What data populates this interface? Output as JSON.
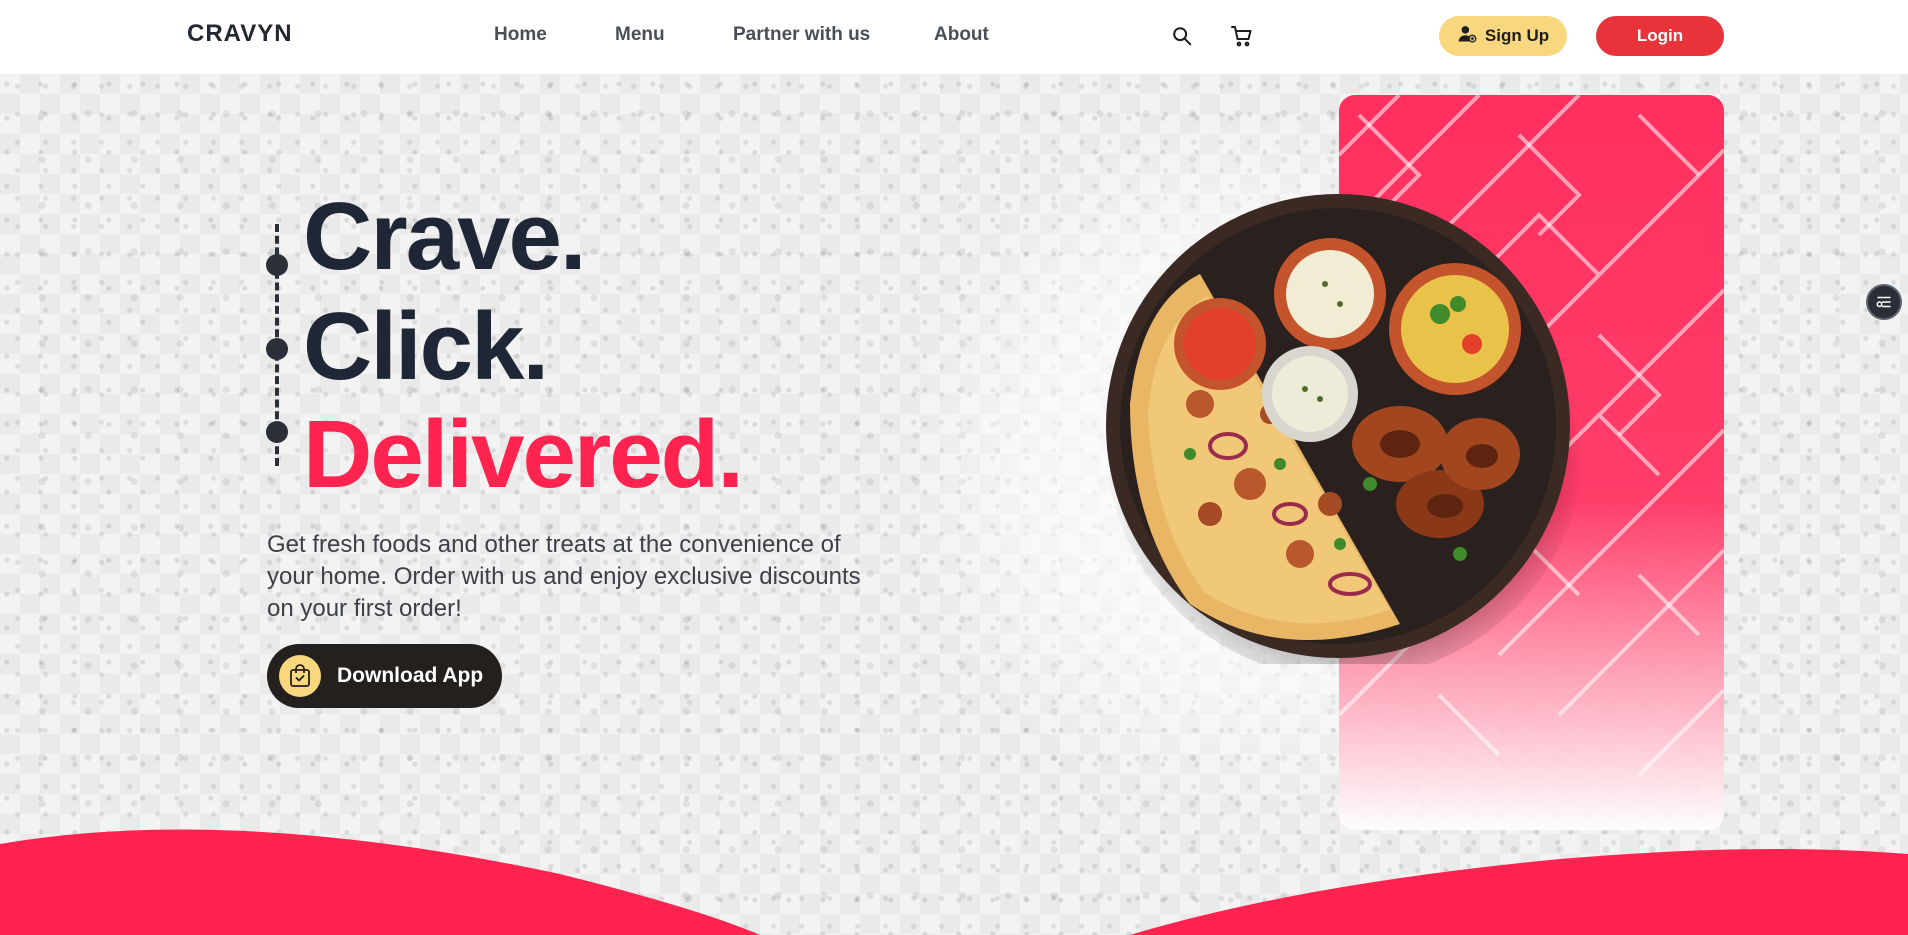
{
  "header": {
    "brand": "CRAVYN",
    "nav": [
      "Home",
      "Menu",
      "Partner with us",
      "About"
    ],
    "signup_label": "Sign Up",
    "login_label": "Login"
  },
  "hero": {
    "line1": "Crave.",
    "line2": "Click.",
    "line3": "Delivered.",
    "description": "Get fresh foods and other treats at the convenience of your home. Order with us and enjoy exclusive discounts on your first order!",
    "download_label": "Download App"
  },
  "icons": {
    "search": "search-icon",
    "cart": "cart-icon",
    "user_add": "user-add-icon",
    "bag": "shopping-bag-icon",
    "side": "filter-icon"
  },
  "colors": {
    "accent_red": "#ff2350",
    "login_red": "#e8333b",
    "signup_yellow": "#f8d77e",
    "dark": "#1f2737",
    "download_bg": "#23201d"
  }
}
